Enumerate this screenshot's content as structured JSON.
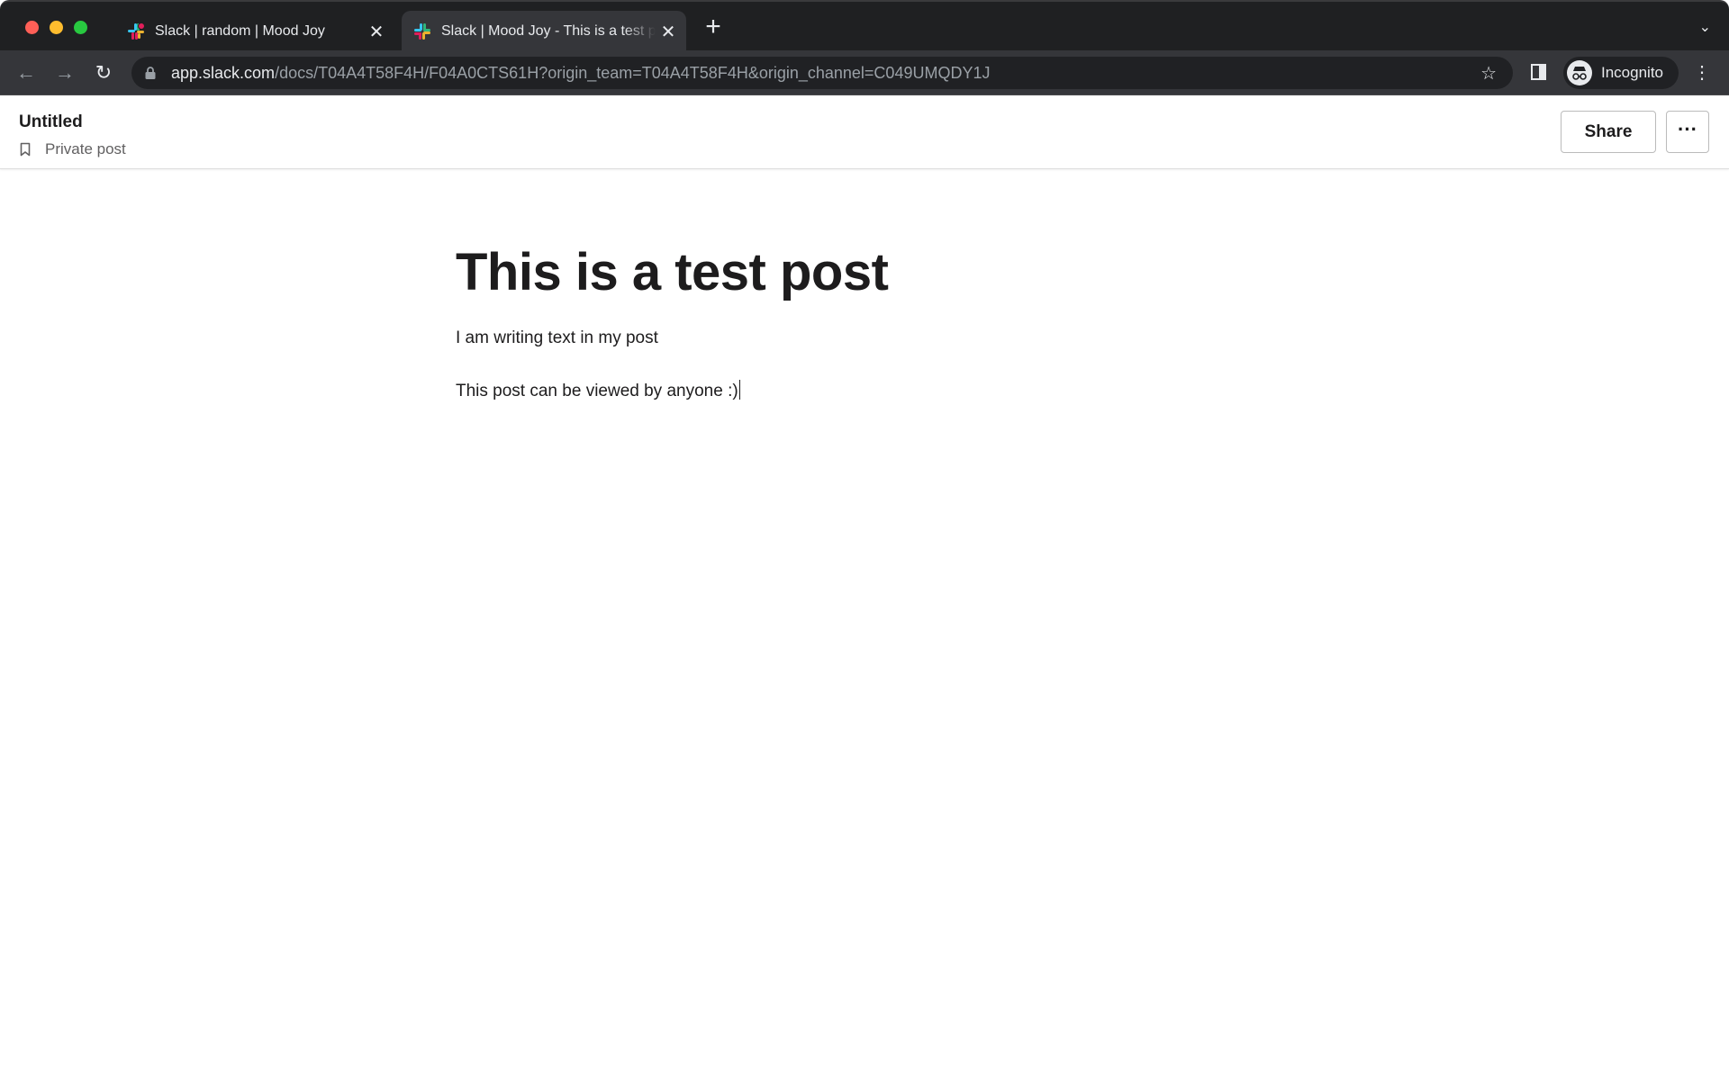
{
  "browser": {
    "tabs": [
      {
        "title": "Slack | random | Mood Joy",
        "active": false,
        "favicon": "slack-logo"
      },
      {
        "title": "Slack | Mood Joy - This is a test post",
        "active": true,
        "favicon": "slack-logo"
      }
    ],
    "tab_close_glyph": "✕",
    "new_tab_glyph": "+",
    "tabs_menu_glyph": "⌄",
    "url_host": "app.slack.com",
    "url_path": "/docs/T04A4T58F4H/F04A0CTS61H?origin_team=T04A4T58F4H&origin_channel=C049UMQDY1J",
    "profile_label": "Incognito",
    "icons": {
      "back": "←",
      "forward": "→",
      "reload": "↻",
      "lock": "🔒",
      "star": "☆",
      "menu": "⋮",
      "incognito": "🕶"
    }
  },
  "doc_header": {
    "title": "Untitled",
    "privacy_label": "Private post",
    "share_label": "Share",
    "more_glyph": "···"
  },
  "post": {
    "title": "This is a test post",
    "paragraphs": [
      "I am writing text in my post",
      "This post can be viewed by anyone :)"
    ]
  }
}
